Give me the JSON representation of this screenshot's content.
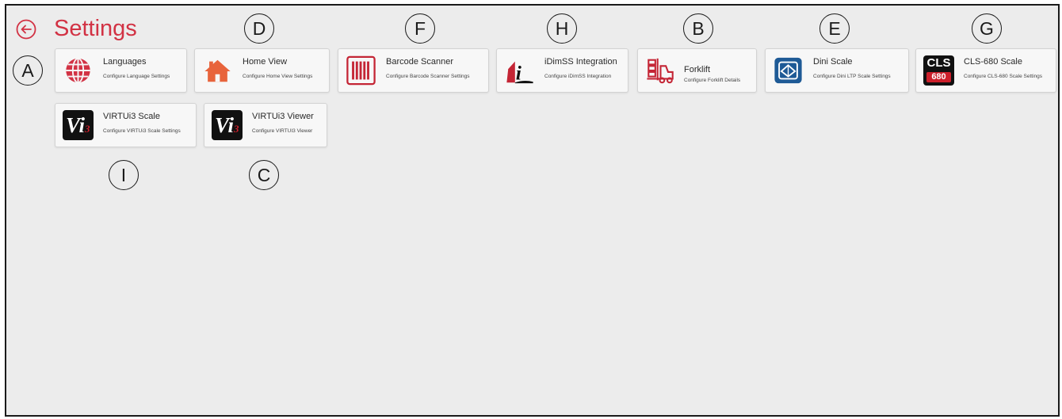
{
  "header": {
    "title": "Settings",
    "back_icon": "back-arrow-icon"
  },
  "colors": {
    "accent": "#d23244",
    "background": "#ececec",
    "tile": "#f7f7f7",
    "dini_blue": "#1e5a96"
  },
  "tiles": [
    {
      "name": "Languages",
      "description": "Configure Language Settings",
      "icon": "globe-icon"
    },
    {
      "name": "Home View",
      "description": "Configure Home View Settings",
      "icon": "home-icon"
    },
    {
      "name": "Barcode Scanner",
      "description": "Configure Barcode Scanner Settings",
      "icon": "barcode-icon"
    },
    {
      "name": "iDimSS Integration",
      "description": "Configure iDimSS Integration",
      "icon": "idimss-icon"
    },
    {
      "name": "Forklift",
      "description": "Configure Forklift Details",
      "icon": "forklift-icon"
    },
    {
      "name": "Dini Scale",
      "description": "Configure Dini LTP Scale Settings",
      "icon": "dini-scale-icon"
    },
    {
      "name": "CLS-680 Scale",
      "description": "Configure CLS-680 Scale Settings",
      "icon": "cls680-icon",
      "badge_top": "CLS",
      "badge_bottom": "680"
    },
    {
      "name": "VIRTUi3 Scale",
      "description": "Configure VIRTUi3 Scale Settings",
      "icon": "virtui3-icon",
      "badge": "Vi",
      "badge_sub": "3"
    },
    {
      "name": "VIRTUi3 Viewer",
      "description": "Configure VIRTUI3 Viewer",
      "icon": "virtui3-icon",
      "badge": "Vi",
      "badge_sub": "3"
    }
  ],
  "callouts": [
    "A",
    "D",
    "F",
    "H",
    "B",
    "E",
    "G",
    "I",
    "C"
  ]
}
